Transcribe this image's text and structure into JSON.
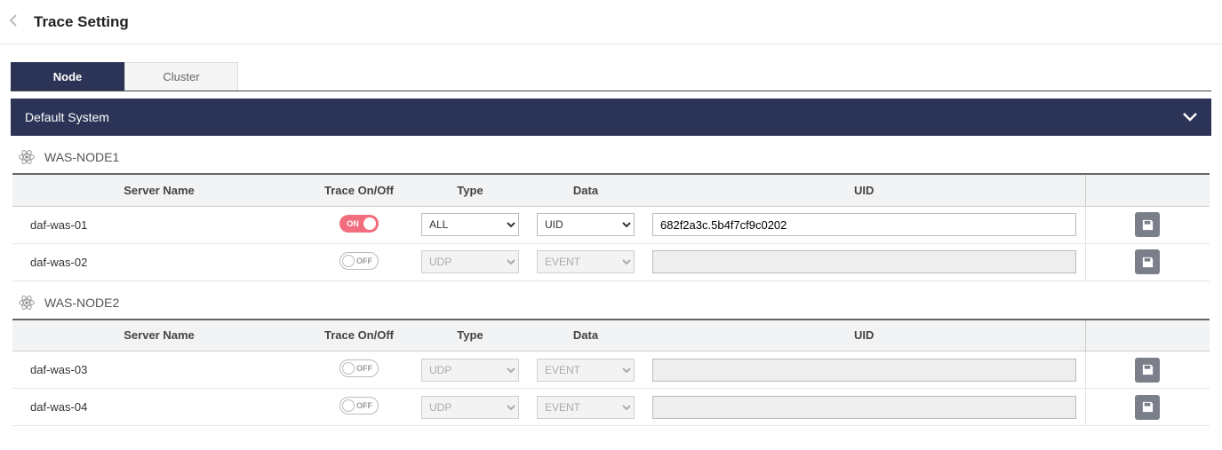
{
  "pageTitle": "Trace Setting",
  "tabs": {
    "node": "Node",
    "cluster": "Cluster"
  },
  "section": {
    "title": "Default System"
  },
  "columns": {
    "serverName": "Server Name",
    "traceOnOff": "Trace On/Off",
    "type": "Type",
    "data": "Data",
    "uid": "UID"
  },
  "toggleLabels": {
    "on": "ON",
    "off": "OFF"
  },
  "typeOptions": {
    "all": "ALL",
    "udp": "UDP"
  },
  "dataOptions": {
    "uid": "UID",
    "event": "EVENT"
  },
  "nodes": [
    {
      "name": "WAS-NODE1",
      "rows": [
        {
          "server": "daf-was-01",
          "on": true,
          "type": "ALL",
          "data": "UID",
          "uid": "682f2a3c.5b4f7cf9c0202"
        },
        {
          "server": "daf-was-02",
          "on": false,
          "type": "UDP",
          "data": "EVENT",
          "uid": ""
        }
      ]
    },
    {
      "name": "WAS-NODE2",
      "rows": [
        {
          "server": "daf-was-03",
          "on": false,
          "type": "UDP",
          "data": "EVENT",
          "uid": ""
        },
        {
          "server": "daf-was-04",
          "on": false,
          "type": "UDP",
          "data": "EVENT",
          "uid": ""
        }
      ]
    }
  ]
}
